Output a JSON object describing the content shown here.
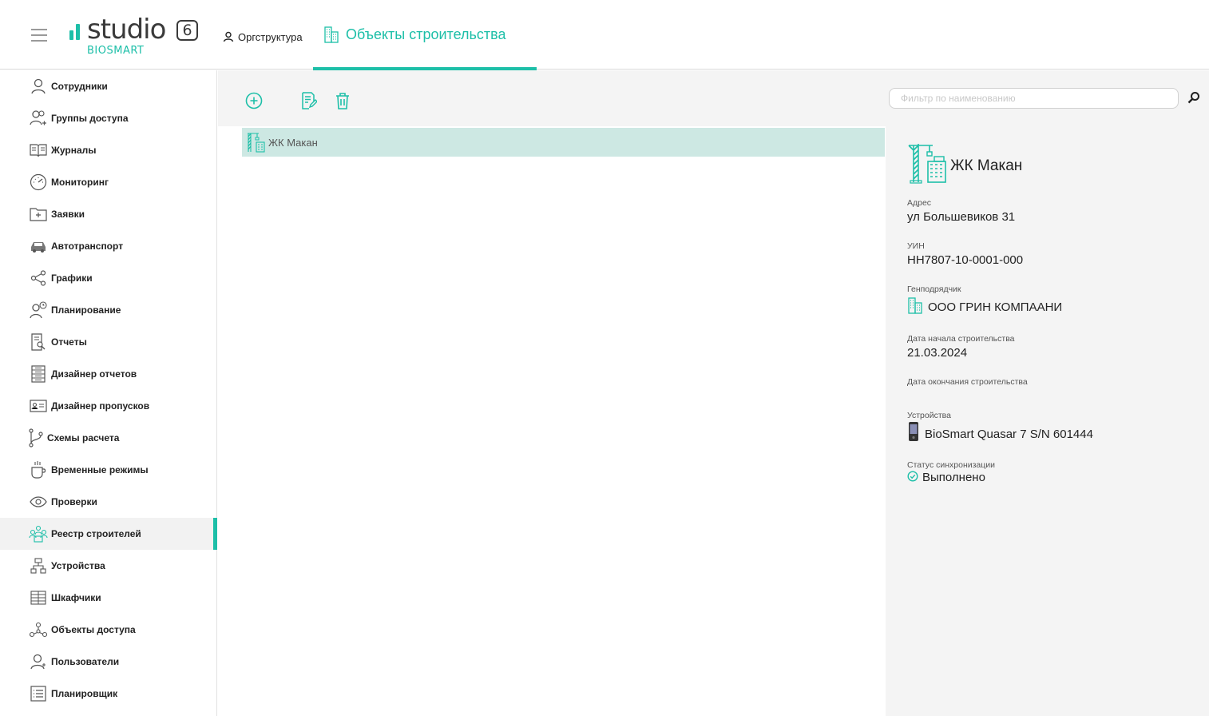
{
  "app": {
    "logo_word": "studio",
    "logo_version": "6",
    "logo_sub": "BIOSMART"
  },
  "header": {
    "org_label": "Оргструктура",
    "objects_label": "Объекты строительства"
  },
  "sidebar": {
    "items": [
      {
        "label": "Сотрудники",
        "icon": "user-icon"
      },
      {
        "label": "Группы доступа",
        "icon": "users-group-icon"
      },
      {
        "label": "Журналы",
        "icon": "book-icon"
      },
      {
        "label": "Мониторинг",
        "icon": "gauge-icon"
      },
      {
        "label": "Заявки",
        "icon": "folder-plus-icon"
      },
      {
        "label": "Автотранспорт",
        "icon": "car-icon"
      },
      {
        "label": "Графики",
        "icon": "share-nodes-icon"
      },
      {
        "label": "Планирование",
        "icon": "user-clock-icon"
      },
      {
        "label": "Отчеты",
        "icon": "report-search-icon"
      },
      {
        "label": "Дизайнер отчетов",
        "icon": "report-designer-icon"
      },
      {
        "label": "Дизайнер пропусков",
        "icon": "id-card-icon"
      },
      {
        "label": "Схемы расчета",
        "icon": "branch-icon"
      },
      {
        "label": "Временные режимы",
        "icon": "coffee-cup-icon"
      },
      {
        "label": "Проверки",
        "icon": "eye-icon"
      },
      {
        "label": "Реестр строителей",
        "icon": "builders-registry-icon",
        "active": true
      },
      {
        "label": "Устройства",
        "icon": "network-icon"
      },
      {
        "label": "Шкафчики",
        "icon": "lockers-icon"
      },
      {
        "label": "Объекты доступа",
        "icon": "nodes-icon"
      },
      {
        "label": "Пользователи",
        "icon": "user-add-icon"
      },
      {
        "label": "Планировщик",
        "icon": "list-icon"
      }
    ]
  },
  "toolbar": {
    "filter_placeholder": "Фильтр по наименованию"
  },
  "list": {
    "rows": [
      {
        "name": "ЖК Макан"
      }
    ]
  },
  "details": {
    "title": "ЖК Макан",
    "address_label": "Адрес",
    "address_value": "ул Большевиков 31",
    "uin_label": "УИН",
    "uin_value": "НН7807-10-0001-000",
    "contractor_label": "Генподрядчик",
    "contractor_value": "ООО ГРИН КОМПААНИ",
    "start_label": "Дата начала строительства",
    "start_value": "21.03.2024",
    "end_label": "Дата окончания строительства",
    "end_value": "",
    "devices_label": "Устройства",
    "devices_value": "BioSmart Quasar 7 S/N 601444",
    "sync_label": "Статус синхронизации",
    "sync_value": "Выполнено"
  },
  "colors": {
    "accent": "#1dbfa8",
    "selected_row": "#cde8e3",
    "panel_bg": "#f4f4f4"
  }
}
